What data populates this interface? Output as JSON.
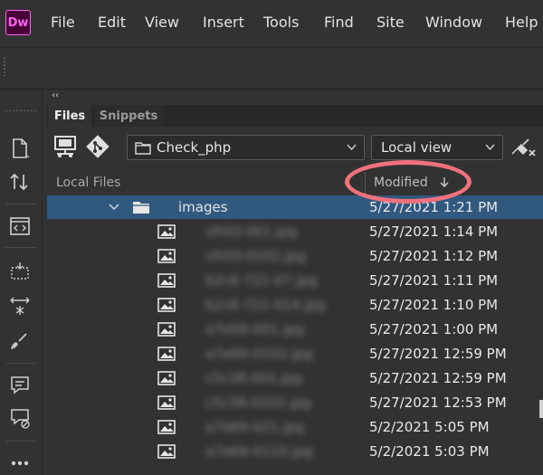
{
  "app": {
    "logo_text": "Dw",
    "brand_color": "#ff61f6"
  },
  "menu": [
    "File",
    "Edit",
    "View",
    "Insert",
    "Tools",
    "Find",
    "Site",
    "Window",
    "Help"
  ],
  "panel": {
    "collapse_glyph": "‹‹",
    "tabs": [
      "Files",
      "Snippets"
    ],
    "site_selector": {
      "value": "Check_php",
      "icon": "folder-icon"
    },
    "view_selector": {
      "value": "Local view"
    },
    "columns": {
      "local_files": "Local Files",
      "modified": "Modified",
      "sort": "descending"
    }
  },
  "left_toolbar_icons": [
    "new-document-icon",
    "get-put-icon",
    "code-view-icon",
    "insert-panel-icon",
    "properties-icon",
    "brush-icon",
    "comment-icon",
    "comment-off-icon",
    "more-icon"
  ],
  "files": [
    {
      "name": "images",
      "type": "folder",
      "expanded": true,
      "selected": true,
      "modified": "5/27/2021 1:21 PM"
    },
    {
      "name": "vfr03-001.jpg",
      "type": "image",
      "modified": "5/27/2021 1:14 PM"
    },
    {
      "name": "vfr03-0102.jpg",
      "type": "image",
      "modified": "5/27/2021 1:12 PM"
    },
    {
      "name": "b2c6-721-07.jpg",
      "type": "image",
      "modified": "5/27/2021 1:11 PM"
    },
    {
      "name": "b2c6-721-014.jpg",
      "type": "image",
      "modified": "5/27/2021 1:10 PM"
    },
    {
      "name": "a7e69-001.jpg",
      "type": "image",
      "modified": "5/27/2021 1:00 PM"
    },
    {
      "name": "a7e69-0102.jpg",
      "type": "image",
      "modified": "5/27/2021 12:59 PM"
    },
    {
      "name": "c5c38-001.jpg",
      "type": "image",
      "modified": "5/27/2021 12:59 PM"
    },
    {
      "name": "c5c38-0102.jpg",
      "type": "image",
      "modified": "5/27/2021 12:53 PM"
    },
    {
      "name": "a7e69-b21.jpg",
      "type": "image",
      "modified": "5/2/2021 5:05 PM"
    },
    {
      "name": "a7e69-0110.jpg",
      "type": "image",
      "modified": "5/2/2021 5:03 PM"
    }
  ],
  "highlight_color": "#f0707c"
}
